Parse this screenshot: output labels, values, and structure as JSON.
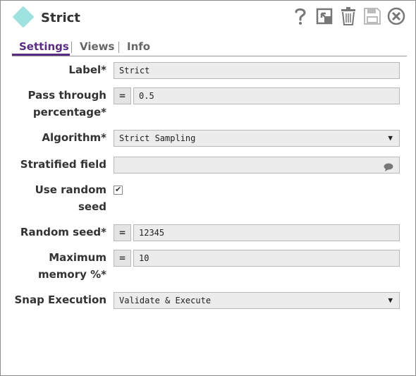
{
  "header": {
    "title": "Strict",
    "toolbar": {
      "help_icon": "question-icon",
      "resize_icon": "expand-icon",
      "delete_icon": "trash-icon",
      "save_icon": "save-icon",
      "close_icon": "close-icon"
    }
  },
  "tabs": [
    {
      "label": "Settings",
      "active": true
    },
    {
      "label": "Views",
      "active": false
    },
    {
      "label": "Info",
      "active": false
    }
  ],
  "form": {
    "label": {
      "label": "Label*",
      "value": "Strict"
    },
    "pass_through": {
      "label_line1": "Pass through",
      "label_line2": "percentage*",
      "expr_button": "=",
      "value": "0.5"
    },
    "algorithm": {
      "label": "Algorithm*",
      "value": "Strict Sampling"
    },
    "stratified_field": {
      "label": "Stratified field",
      "value": ""
    },
    "use_random_seed": {
      "label_line1": "Use random",
      "label_line2": "seed",
      "checked": true
    },
    "random_seed": {
      "label": "Random seed*",
      "expr_button": "=",
      "value": "12345"
    },
    "max_memory": {
      "label_line1": "Maximum",
      "label_line2": "memory %*",
      "expr_button": "=",
      "value": "10"
    },
    "snap_execution": {
      "label": "Snap Execution",
      "value": "Validate & Execute"
    }
  },
  "colors": {
    "accent": "#5a2d82",
    "logo": "#9fe3e0",
    "field_bg": "#ececec"
  }
}
